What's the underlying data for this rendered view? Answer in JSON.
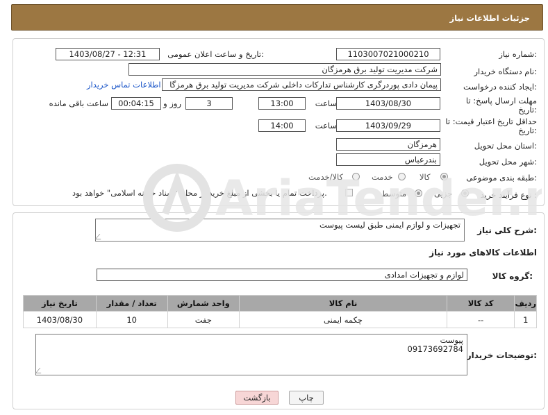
{
  "header": {
    "title": "جزئیات اطلاعات نیاز"
  },
  "form": {
    "need_number": {
      "label": "شماره نیاز:",
      "value": "1103007021000210"
    },
    "announce_datetime": {
      "label": "تاریخ و ساعت اعلان عمومی:",
      "value": "1403/08/27 - 12:31"
    },
    "buyer_org": {
      "label": "نام دستگاه خریدار:",
      "value": "شرکت مدیریت تولید برق هرمزگان"
    },
    "requester": {
      "label": "ایجاد کننده درخواست:",
      "value": "پیمان دادی پوردرگری کارشناس تدارکات داخلی شرکت مدیریت تولید برق هرمزگا",
      "contact_link": "اطلاعات تماس خریدار"
    },
    "reply_deadline": {
      "label_line1": "مهلت ارسال پاسخ: تا",
      "label_line2": "تاریخ:",
      "date": "1403/08/30",
      "time_label": "ساعت",
      "time": "13:00",
      "days": "3",
      "days_label": "روز و",
      "remaining": "00:04:15",
      "remaining_label": "ساعت باقی مانده"
    },
    "price_validity": {
      "label_line1": "حداقل تاریخ اعتبار قیمت: تا",
      "label_line2": "تاریخ:",
      "date": "1403/09/29",
      "time_label": "ساعت",
      "time": "14:00"
    },
    "delivery_province": {
      "label": "استان محل تحویل:",
      "value": "هرمزگان"
    },
    "delivery_city": {
      "label": "شهر محل تحویل:",
      "value": "بندرعباس"
    },
    "category": {
      "label": "طبقه بندی موضوعی:",
      "options": [
        "کالا",
        "خدمت",
        "کالا/خدمت"
      ],
      "selected": "کالا"
    },
    "purchase_process": {
      "label": "نوع فرآیند خرید :",
      "options": [
        "جزیی",
        "متوسط"
      ],
      "selected": "جزیی",
      "payment_note": "پرداخت تمام یا بخشی از مبلغ خرید،از محل \"اسناد خزانه اسلامی\" خواهد بود."
    }
  },
  "details": {
    "summary_label": "شرح کلی نیاز:",
    "summary_value": "تجهیزات و لوازم ایمنی طبق لیست پیوست",
    "goods_info_title": "اطلاعات کالاهای مورد نیاز",
    "goods_group_label": "گروه کالا:",
    "goods_group_value": "لوازم و تجهیزات امدادی",
    "table": {
      "headers": [
        "ردیف",
        "کد کالا",
        "نام کالا",
        "واحد شمارش",
        "تعداد / مقدار",
        "تاریخ نیاز"
      ],
      "rows": [
        [
          "1",
          "--",
          "چکمه ایمنی",
          "جفت",
          "10",
          "1403/08/30"
        ]
      ]
    },
    "buyer_notes_label": "توضیحات خریدار:",
    "buyer_notes_line1": "پیوست",
    "buyer_notes_line2": "09173692784"
  },
  "buttons": {
    "print": "چاپ",
    "back": "بازگشت"
  },
  "watermark": {
    "text": "AriaTender.neT"
  },
  "colors": {
    "header": "#9c7742",
    "table_header": "#a8a8a8",
    "link": "#1a55c8",
    "back_button": "#f7d6d6"
  }
}
